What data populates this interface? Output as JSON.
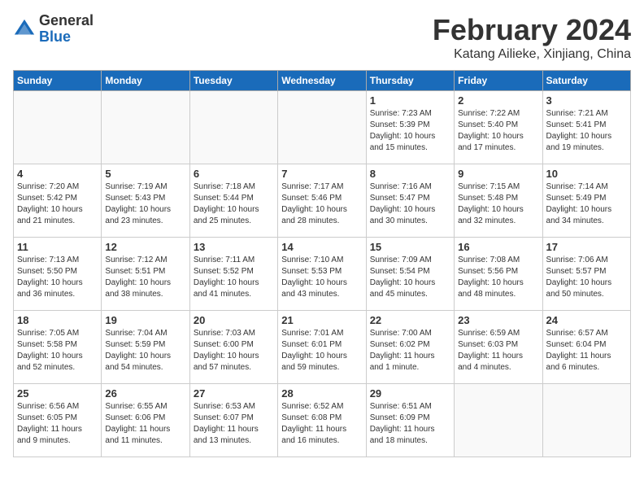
{
  "header": {
    "logo_general": "General",
    "logo_blue": "Blue",
    "month_title": "February 2024",
    "location": "Katang Ailieke, Xinjiang, China"
  },
  "weekdays": [
    "Sunday",
    "Monday",
    "Tuesday",
    "Wednesday",
    "Thursday",
    "Friday",
    "Saturday"
  ],
  "weeks": [
    [
      {
        "day": "",
        "info": ""
      },
      {
        "day": "",
        "info": ""
      },
      {
        "day": "",
        "info": ""
      },
      {
        "day": "",
        "info": ""
      },
      {
        "day": "1",
        "info": "Sunrise: 7:23 AM\nSunset: 5:39 PM\nDaylight: 10 hours\nand 15 minutes."
      },
      {
        "day": "2",
        "info": "Sunrise: 7:22 AM\nSunset: 5:40 PM\nDaylight: 10 hours\nand 17 minutes."
      },
      {
        "day": "3",
        "info": "Sunrise: 7:21 AM\nSunset: 5:41 PM\nDaylight: 10 hours\nand 19 minutes."
      }
    ],
    [
      {
        "day": "4",
        "info": "Sunrise: 7:20 AM\nSunset: 5:42 PM\nDaylight: 10 hours\nand 21 minutes."
      },
      {
        "day": "5",
        "info": "Sunrise: 7:19 AM\nSunset: 5:43 PM\nDaylight: 10 hours\nand 23 minutes."
      },
      {
        "day": "6",
        "info": "Sunrise: 7:18 AM\nSunset: 5:44 PM\nDaylight: 10 hours\nand 25 minutes."
      },
      {
        "day": "7",
        "info": "Sunrise: 7:17 AM\nSunset: 5:46 PM\nDaylight: 10 hours\nand 28 minutes."
      },
      {
        "day": "8",
        "info": "Sunrise: 7:16 AM\nSunset: 5:47 PM\nDaylight: 10 hours\nand 30 minutes."
      },
      {
        "day": "9",
        "info": "Sunrise: 7:15 AM\nSunset: 5:48 PM\nDaylight: 10 hours\nand 32 minutes."
      },
      {
        "day": "10",
        "info": "Sunrise: 7:14 AM\nSunset: 5:49 PM\nDaylight: 10 hours\nand 34 minutes."
      }
    ],
    [
      {
        "day": "11",
        "info": "Sunrise: 7:13 AM\nSunset: 5:50 PM\nDaylight: 10 hours\nand 36 minutes."
      },
      {
        "day": "12",
        "info": "Sunrise: 7:12 AM\nSunset: 5:51 PM\nDaylight: 10 hours\nand 38 minutes."
      },
      {
        "day": "13",
        "info": "Sunrise: 7:11 AM\nSunset: 5:52 PM\nDaylight: 10 hours\nand 41 minutes."
      },
      {
        "day": "14",
        "info": "Sunrise: 7:10 AM\nSunset: 5:53 PM\nDaylight: 10 hours\nand 43 minutes."
      },
      {
        "day": "15",
        "info": "Sunrise: 7:09 AM\nSunset: 5:54 PM\nDaylight: 10 hours\nand 45 minutes."
      },
      {
        "day": "16",
        "info": "Sunrise: 7:08 AM\nSunset: 5:56 PM\nDaylight: 10 hours\nand 48 minutes."
      },
      {
        "day": "17",
        "info": "Sunrise: 7:06 AM\nSunset: 5:57 PM\nDaylight: 10 hours\nand 50 minutes."
      }
    ],
    [
      {
        "day": "18",
        "info": "Sunrise: 7:05 AM\nSunset: 5:58 PM\nDaylight: 10 hours\nand 52 minutes."
      },
      {
        "day": "19",
        "info": "Sunrise: 7:04 AM\nSunset: 5:59 PM\nDaylight: 10 hours\nand 54 minutes."
      },
      {
        "day": "20",
        "info": "Sunrise: 7:03 AM\nSunset: 6:00 PM\nDaylight: 10 hours\nand 57 minutes."
      },
      {
        "day": "21",
        "info": "Sunrise: 7:01 AM\nSunset: 6:01 PM\nDaylight: 10 hours\nand 59 minutes."
      },
      {
        "day": "22",
        "info": "Sunrise: 7:00 AM\nSunset: 6:02 PM\nDaylight: 11 hours\nand 1 minute."
      },
      {
        "day": "23",
        "info": "Sunrise: 6:59 AM\nSunset: 6:03 PM\nDaylight: 11 hours\nand 4 minutes."
      },
      {
        "day": "24",
        "info": "Sunrise: 6:57 AM\nSunset: 6:04 PM\nDaylight: 11 hours\nand 6 minutes."
      }
    ],
    [
      {
        "day": "25",
        "info": "Sunrise: 6:56 AM\nSunset: 6:05 PM\nDaylight: 11 hours\nand 9 minutes."
      },
      {
        "day": "26",
        "info": "Sunrise: 6:55 AM\nSunset: 6:06 PM\nDaylight: 11 hours\nand 11 minutes."
      },
      {
        "day": "27",
        "info": "Sunrise: 6:53 AM\nSunset: 6:07 PM\nDaylight: 11 hours\nand 13 minutes."
      },
      {
        "day": "28",
        "info": "Sunrise: 6:52 AM\nSunset: 6:08 PM\nDaylight: 11 hours\nand 16 minutes."
      },
      {
        "day": "29",
        "info": "Sunrise: 6:51 AM\nSunset: 6:09 PM\nDaylight: 11 hours\nand 18 minutes."
      },
      {
        "day": "",
        "info": ""
      },
      {
        "day": "",
        "info": ""
      }
    ]
  ]
}
